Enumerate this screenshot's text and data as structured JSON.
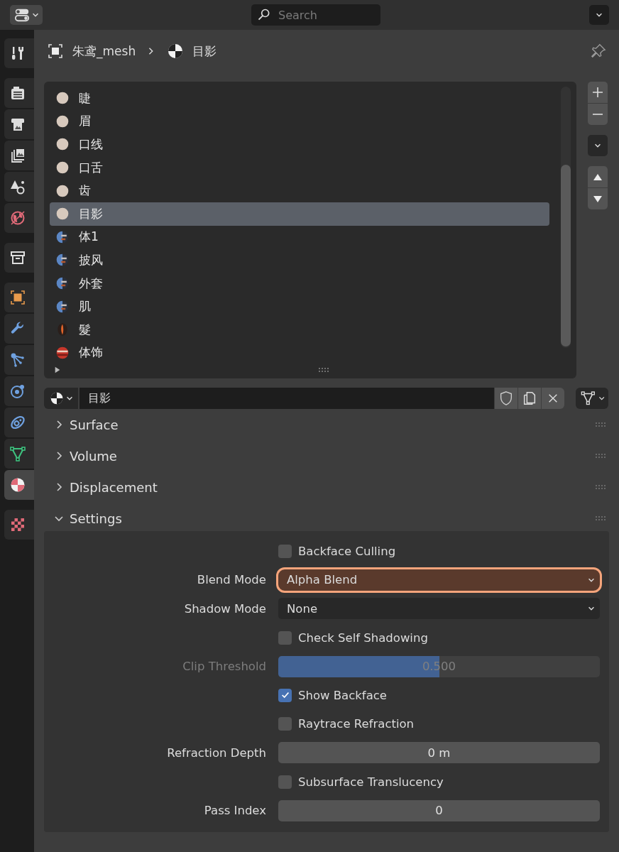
{
  "header": {
    "search": {
      "placeholder": "Search"
    }
  },
  "property_tabs": [
    {
      "tabs": [
        {
          "kind": "tool",
          "selected": false
        }
      ]
    },
    {
      "tabs": [
        {
          "kind": "render",
          "selected": false
        },
        {
          "kind": "output",
          "selected": false
        },
        {
          "kind": "view_layer",
          "selected": false
        },
        {
          "kind": "scene",
          "selected": false
        },
        {
          "kind": "world",
          "selected": false
        }
      ]
    },
    {
      "tabs": [
        {
          "kind": "collection",
          "selected": false
        }
      ]
    },
    {
      "tabs": [
        {
          "kind": "object",
          "selected": false
        },
        {
          "kind": "modifiers",
          "selected": false
        },
        {
          "kind": "particles",
          "selected": false
        },
        {
          "kind": "physics",
          "selected": false
        },
        {
          "kind": "constraints",
          "selected": false
        },
        {
          "kind": "data",
          "selected": false
        },
        {
          "kind": "material",
          "selected": true
        }
      ]
    },
    {
      "tabs": [
        {
          "kind": "texture",
          "selected": false
        }
      ]
    }
  ],
  "breadcrumb": [
    {
      "kind": "object",
      "label": "朱鸢_mesh"
    },
    {
      "kind": "material",
      "label": "目影"
    }
  ],
  "material_slots": {
    "items": [
      {
        "name": "睫",
        "kind": "plain",
        "selected": false
      },
      {
        "name": "眉",
        "kind": "plain",
        "selected": false
      },
      {
        "name": "口线",
        "kind": "plain",
        "selected": false
      },
      {
        "name": "口舌",
        "kind": "plain",
        "selected": false
      },
      {
        "name": "齿",
        "kind": "plain",
        "selected": false
      },
      {
        "name": "目影",
        "kind": "plain",
        "selected": true
      },
      {
        "name": "体1",
        "kind": "blue",
        "selected": false
      },
      {
        "name": "披风",
        "kind": "blue",
        "selected": false
      },
      {
        "name": "外套",
        "kind": "blue",
        "selected": false
      },
      {
        "name": "肌",
        "kind": "blue",
        "selected": false
      },
      {
        "name": "髮",
        "kind": "hair",
        "selected": false
      },
      {
        "name": "体饰",
        "kind": "red",
        "selected": false
      }
    ]
  },
  "material_slot": {
    "name": "目影"
  },
  "panels": [
    {
      "title": "Surface",
      "expanded": false
    },
    {
      "title": "Volume",
      "expanded": false
    },
    {
      "title": "Displacement",
      "expanded": false
    },
    {
      "title": "Settings",
      "expanded": true,
      "rows": [
        {
          "kind": "checkbox",
          "label": "Backface Culling",
          "checked": false
        },
        {
          "kind": "dropdown",
          "label": "Blend Mode",
          "value": "Alpha Blend",
          "highlighted": true
        },
        {
          "kind": "dropdown",
          "label": "Shadow Mode",
          "value": "None",
          "highlighted": false
        },
        {
          "kind": "checkbox",
          "label": "Check Self Shadowing",
          "checked": false
        },
        {
          "kind": "slider",
          "label": "Clip Threshold",
          "value": "0.500",
          "level": 0.5,
          "disabled": true
        },
        {
          "kind": "checkbox",
          "label": "Show Backface",
          "checked": true
        },
        {
          "kind": "checkbox",
          "label": "Raytrace Refraction",
          "checked": false
        },
        {
          "kind": "number",
          "label": "Refraction Depth",
          "value": "0 m"
        },
        {
          "kind": "checkbox",
          "label": "Subsurface Translucency",
          "checked": false
        },
        {
          "kind": "number",
          "label": "Pass Index",
          "value": "0"
        }
      ]
    }
  ]
}
